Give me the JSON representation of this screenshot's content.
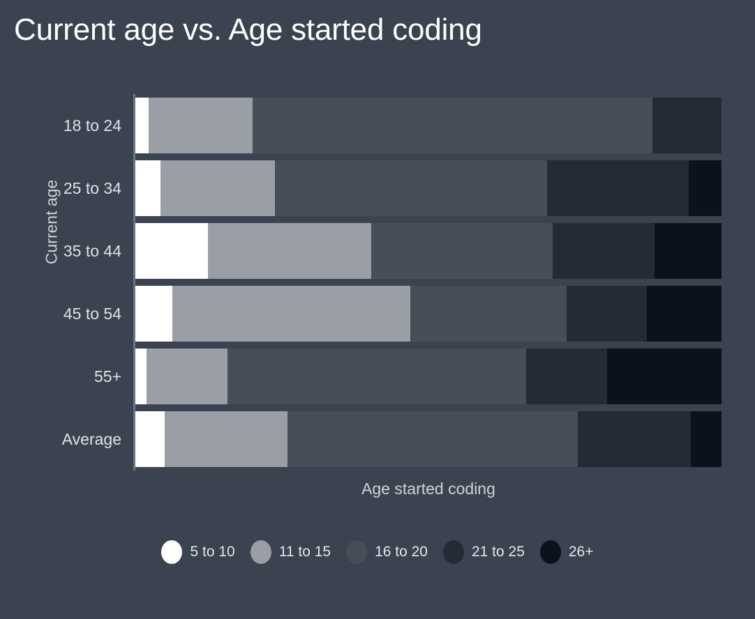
{
  "chart_data": {
    "type": "bar",
    "subtype": "stacked-horizontal-100-percent",
    "title": "Current age vs. Age started coding",
    "xlabel": "Age started coding",
    "ylabel": "Current age",
    "grid": false,
    "legend_position": "bottom",
    "categories": [
      "18 to 24",
      "25 to 34",
      "35 to 44",
      "45 to 54",
      "55+",
      "Average"
    ],
    "series": [
      {
        "name": "5 to 10",
        "color": "#ffffff",
        "values": [
          2.3,
          4.3,
          12.4,
          6.3,
          1.9,
          5.0
        ]
      },
      {
        "name": "11 to 15",
        "color": "#9a9ea5",
        "values": [
          17.7,
          19.5,
          27.9,
          40.6,
          13.8,
          21.0
        ]
      },
      {
        "name": "16 to 20",
        "color": "#474e57",
        "values": [
          68.2,
          46.4,
          31.0,
          26.7,
          51.0,
          49.5
        ]
      },
      {
        "name": "21 to 25",
        "color": "#252b35",
        "values": [
          11.8,
          24.2,
          17.4,
          13.7,
          13.8,
          19.3
        ]
      },
      {
        "name": "26+",
        "color": "#0c121c",
        "values": [
          0.0,
          5.6,
          11.4,
          12.7,
          19.5,
          5.2
        ]
      }
    ],
    "xlim": [
      0,
      100
    ],
    "units": "percent"
  },
  "theme": {
    "background": "#3b4250",
    "title_color": "#ffffff",
    "axis_label_color": "#cfd3d8",
    "tick_label_color": "#dfe2e6",
    "axis_line_color": "#6f7580"
  }
}
